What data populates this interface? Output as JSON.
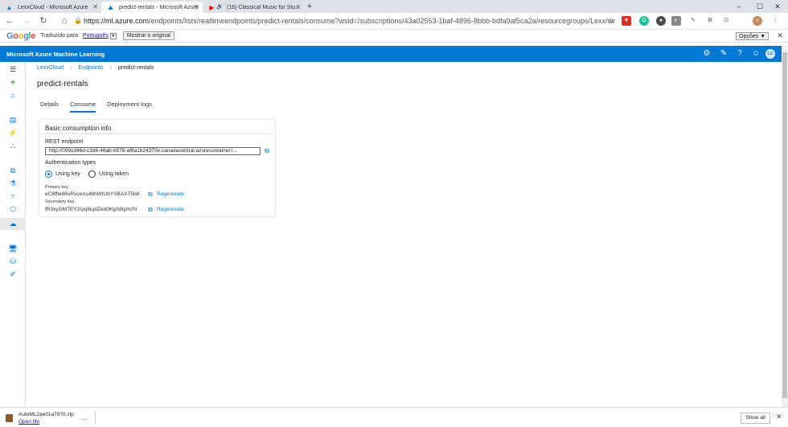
{
  "browser": {
    "tabs": [
      {
        "title": "LexxCloud - Microsoft Azure",
        "active": false,
        "icon": "azure-icon"
      },
      {
        "title": "predict-rentals - Microsoft Azure",
        "active": true,
        "icon": "azure-ml-icon"
      },
      {
        "title": "(16) Classical Music for Stu...",
        "active": false,
        "icon": "youtube-icon"
      }
    ],
    "new_tab": "+",
    "url_host": "https://ml.azure.com",
    "url_path": "/endpoints/lists/realtimeendpoints/predict-rentals/consume?wsid=/subscriptions/43a02553-1baf-4896-8bbb-bdfa9af5ca2a/resourcegroups/Lexx/wor...",
    "minimize": "–",
    "maximize": "☐",
    "close": "✕"
  },
  "translate_bar": {
    "logo": [
      "G",
      "o",
      "o",
      "g",
      "l",
      "e"
    ],
    "label": "Traduzido para:",
    "language": "Português",
    "show_original": "Mostrar o original",
    "options": "Opções ▼",
    "close": "✕"
  },
  "azure_header": {
    "title": "Microsoft Azure Machine Learning",
    "avatar": "LC",
    "accent": "#0078d4"
  },
  "breadcrumb": {
    "workspace": "LexxCloud",
    "endpoints": "Endpoints",
    "current": "predict-rentals"
  },
  "page": {
    "title": "predict-rentals",
    "tabs": [
      "Details",
      "Consume",
      "Deployment logs"
    ],
    "selected_tab": "Consume"
  },
  "card": {
    "title": "Basic consumption info",
    "rest_label": "REST endpoint",
    "rest_value": "http://099cd46d-c3d6-46ab-b576-af8a1b24370e.canadacentral.azurecontainer.i...",
    "auth_label": "Authentication types",
    "auth_options": [
      "Using key",
      "Using token"
    ],
    "auth_selected": "Using key",
    "primary_label": "Primary key",
    "primary_value": "eC8ffle86uRvceAs4bhWtUbYSBAXT5b8",
    "secondary_label": "Secondary key",
    "secondary_value": "fR3xyGM7EY2cjxj8uptZed0KgAt6ymzN",
    "regenerate": "Regenerate"
  },
  "download": {
    "file": "AutoML2ae01a7870.zip",
    "open": "Open file",
    "more": "...",
    "show_all": "Show all",
    "close": "✕"
  }
}
